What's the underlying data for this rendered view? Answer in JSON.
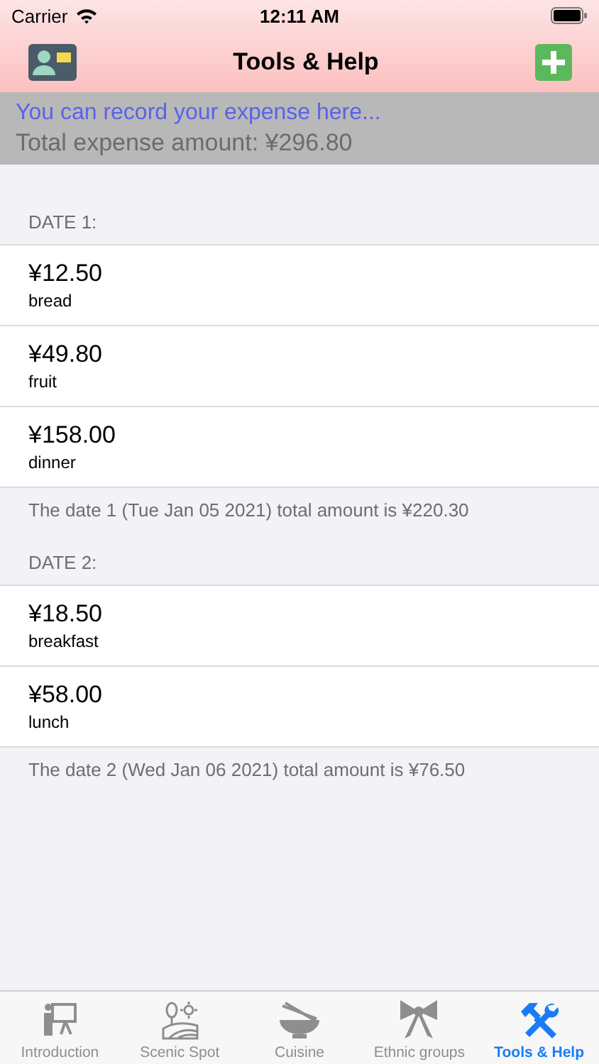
{
  "status_bar": {
    "carrier": "Carrier",
    "time": "12:11 AM"
  },
  "nav": {
    "title": "Tools & Help"
  },
  "header": {
    "hint": "You can record your expense here...",
    "total": "Total expense amount: ¥296.80"
  },
  "sections": [
    {
      "title": "DATE 1:",
      "items": [
        {
          "amount": "¥12.50",
          "name": "bread"
        },
        {
          "amount": "¥49.80",
          "name": "fruit"
        },
        {
          "amount": "¥158.00",
          "name": "dinner"
        }
      ],
      "footer": "The date 1 (Tue Jan 05 2021) total amount is ¥220.30"
    },
    {
      "title": "DATE 2:",
      "items": [
        {
          "amount": "¥18.50",
          "name": "breakfast"
        },
        {
          "amount": "¥58.00",
          "name": "lunch"
        }
      ],
      "footer": "The date 2 (Wed Jan 06 2021) total amount is ¥76.50"
    }
  ],
  "tabs": [
    {
      "label": "Introduction",
      "selected": false
    },
    {
      "label": "Scenic Spot",
      "selected": false
    },
    {
      "label": "Cuisine",
      "selected": false
    },
    {
      "label": "Ethnic groups",
      "selected": false
    },
    {
      "label": "Tools & Help",
      "selected": true
    }
  ]
}
